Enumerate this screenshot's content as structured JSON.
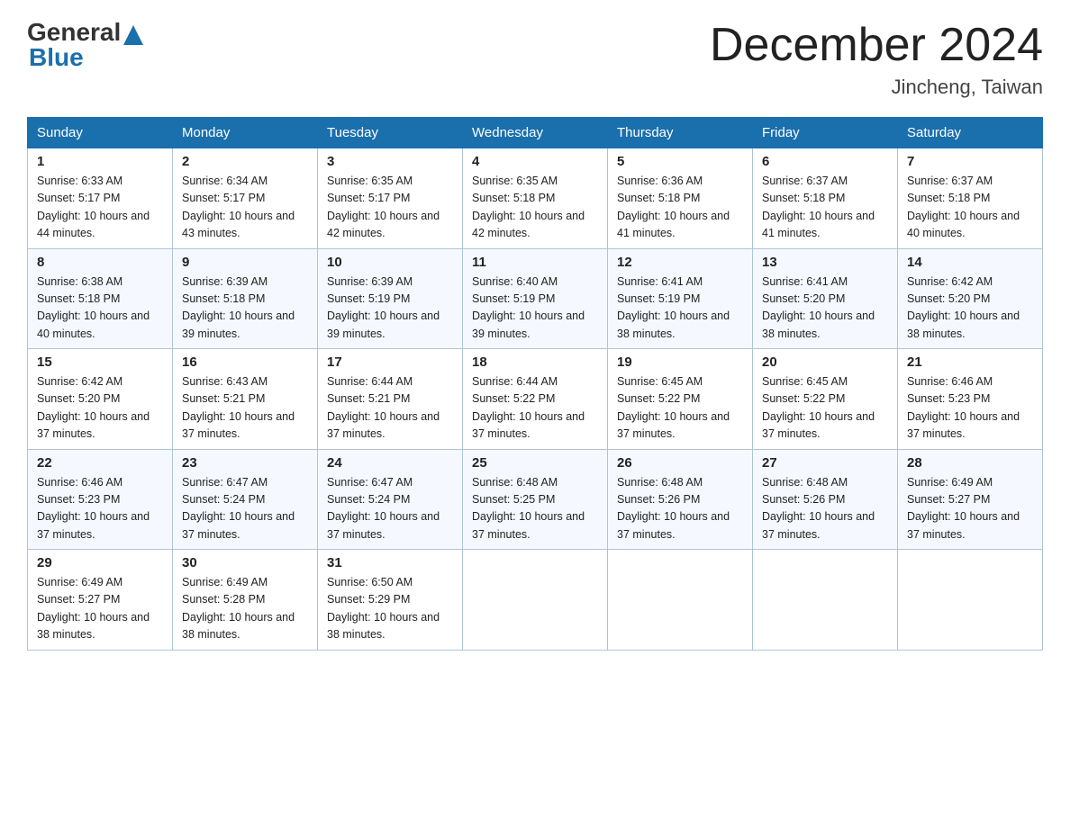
{
  "logo": {
    "general": "General",
    "arrow": "▲",
    "blue": "Blue"
  },
  "title": "December 2024",
  "subtitle": "Jincheng, Taiwan",
  "days_of_week": [
    "Sunday",
    "Monday",
    "Tuesday",
    "Wednesday",
    "Thursday",
    "Friday",
    "Saturday"
  ],
  "weeks": [
    [
      {
        "day": "1",
        "sunrise": "6:33 AM",
        "sunset": "5:17 PM",
        "daylight": "10 hours and 44 minutes."
      },
      {
        "day": "2",
        "sunrise": "6:34 AM",
        "sunset": "5:17 PM",
        "daylight": "10 hours and 43 minutes."
      },
      {
        "day": "3",
        "sunrise": "6:35 AM",
        "sunset": "5:17 PM",
        "daylight": "10 hours and 42 minutes."
      },
      {
        "day": "4",
        "sunrise": "6:35 AM",
        "sunset": "5:18 PM",
        "daylight": "10 hours and 42 minutes."
      },
      {
        "day": "5",
        "sunrise": "6:36 AM",
        "sunset": "5:18 PM",
        "daylight": "10 hours and 41 minutes."
      },
      {
        "day": "6",
        "sunrise": "6:37 AM",
        "sunset": "5:18 PM",
        "daylight": "10 hours and 41 minutes."
      },
      {
        "day": "7",
        "sunrise": "6:37 AM",
        "sunset": "5:18 PM",
        "daylight": "10 hours and 40 minutes."
      }
    ],
    [
      {
        "day": "8",
        "sunrise": "6:38 AM",
        "sunset": "5:18 PM",
        "daylight": "10 hours and 40 minutes."
      },
      {
        "day": "9",
        "sunrise": "6:39 AM",
        "sunset": "5:18 PM",
        "daylight": "10 hours and 39 minutes."
      },
      {
        "day": "10",
        "sunrise": "6:39 AM",
        "sunset": "5:19 PM",
        "daylight": "10 hours and 39 minutes."
      },
      {
        "day": "11",
        "sunrise": "6:40 AM",
        "sunset": "5:19 PM",
        "daylight": "10 hours and 39 minutes."
      },
      {
        "day": "12",
        "sunrise": "6:41 AM",
        "sunset": "5:19 PM",
        "daylight": "10 hours and 38 minutes."
      },
      {
        "day": "13",
        "sunrise": "6:41 AM",
        "sunset": "5:20 PM",
        "daylight": "10 hours and 38 minutes."
      },
      {
        "day": "14",
        "sunrise": "6:42 AM",
        "sunset": "5:20 PM",
        "daylight": "10 hours and 38 minutes."
      }
    ],
    [
      {
        "day": "15",
        "sunrise": "6:42 AM",
        "sunset": "5:20 PM",
        "daylight": "10 hours and 37 minutes."
      },
      {
        "day": "16",
        "sunrise": "6:43 AM",
        "sunset": "5:21 PM",
        "daylight": "10 hours and 37 minutes."
      },
      {
        "day": "17",
        "sunrise": "6:44 AM",
        "sunset": "5:21 PM",
        "daylight": "10 hours and 37 minutes."
      },
      {
        "day": "18",
        "sunrise": "6:44 AM",
        "sunset": "5:22 PM",
        "daylight": "10 hours and 37 minutes."
      },
      {
        "day": "19",
        "sunrise": "6:45 AM",
        "sunset": "5:22 PM",
        "daylight": "10 hours and 37 minutes."
      },
      {
        "day": "20",
        "sunrise": "6:45 AM",
        "sunset": "5:22 PM",
        "daylight": "10 hours and 37 minutes."
      },
      {
        "day": "21",
        "sunrise": "6:46 AM",
        "sunset": "5:23 PM",
        "daylight": "10 hours and 37 minutes."
      }
    ],
    [
      {
        "day": "22",
        "sunrise": "6:46 AM",
        "sunset": "5:23 PM",
        "daylight": "10 hours and 37 minutes."
      },
      {
        "day": "23",
        "sunrise": "6:47 AM",
        "sunset": "5:24 PM",
        "daylight": "10 hours and 37 minutes."
      },
      {
        "day": "24",
        "sunrise": "6:47 AM",
        "sunset": "5:24 PM",
        "daylight": "10 hours and 37 minutes."
      },
      {
        "day": "25",
        "sunrise": "6:48 AM",
        "sunset": "5:25 PM",
        "daylight": "10 hours and 37 minutes."
      },
      {
        "day": "26",
        "sunrise": "6:48 AM",
        "sunset": "5:26 PM",
        "daylight": "10 hours and 37 minutes."
      },
      {
        "day": "27",
        "sunrise": "6:48 AM",
        "sunset": "5:26 PM",
        "daylight": "10 hours and 37 minutes."
      },
      {
        "day": "28",
        "sunrise": "6:49 AM",
        "sunset": "5:27 PM",
        "daylight": "10 hours and 37 minutes."
      }
    ],
    [
      {
        "day": "29",
        "sunrise": "6:49 AM",
        "sunset": "5:27 PM",
        "daylight": "10 hours and 38 minutes."
      },
      {
        "day": "30",
        "sunrise": "6:49 AM",
        "sunset": "5:28 PM",
        "daylight": "10 hours and 38 minutes."
      },
      {
        "day": "31",
        "sunrise": "6:50 AM",
        "sunset": "5:29 PM",
        "daylight": "10 hours and 38 minutes."
      },
      {
        "day": "",
        "sunrise": "",
        "sunset": "",
        "daylight": ""
      },
      {
        "day": "",
        "sunrise": "",
        "sunset": "",
        "daylight": ""
      },
      {
        "day": "",
        "sunrise": "",
        "sunset": "",
        "daylight": ""
      },
      {
        "day": "",
        "sunrise": "",
        "sunset": "",
        "daylight": ""
      }
    ]
  ]
}
